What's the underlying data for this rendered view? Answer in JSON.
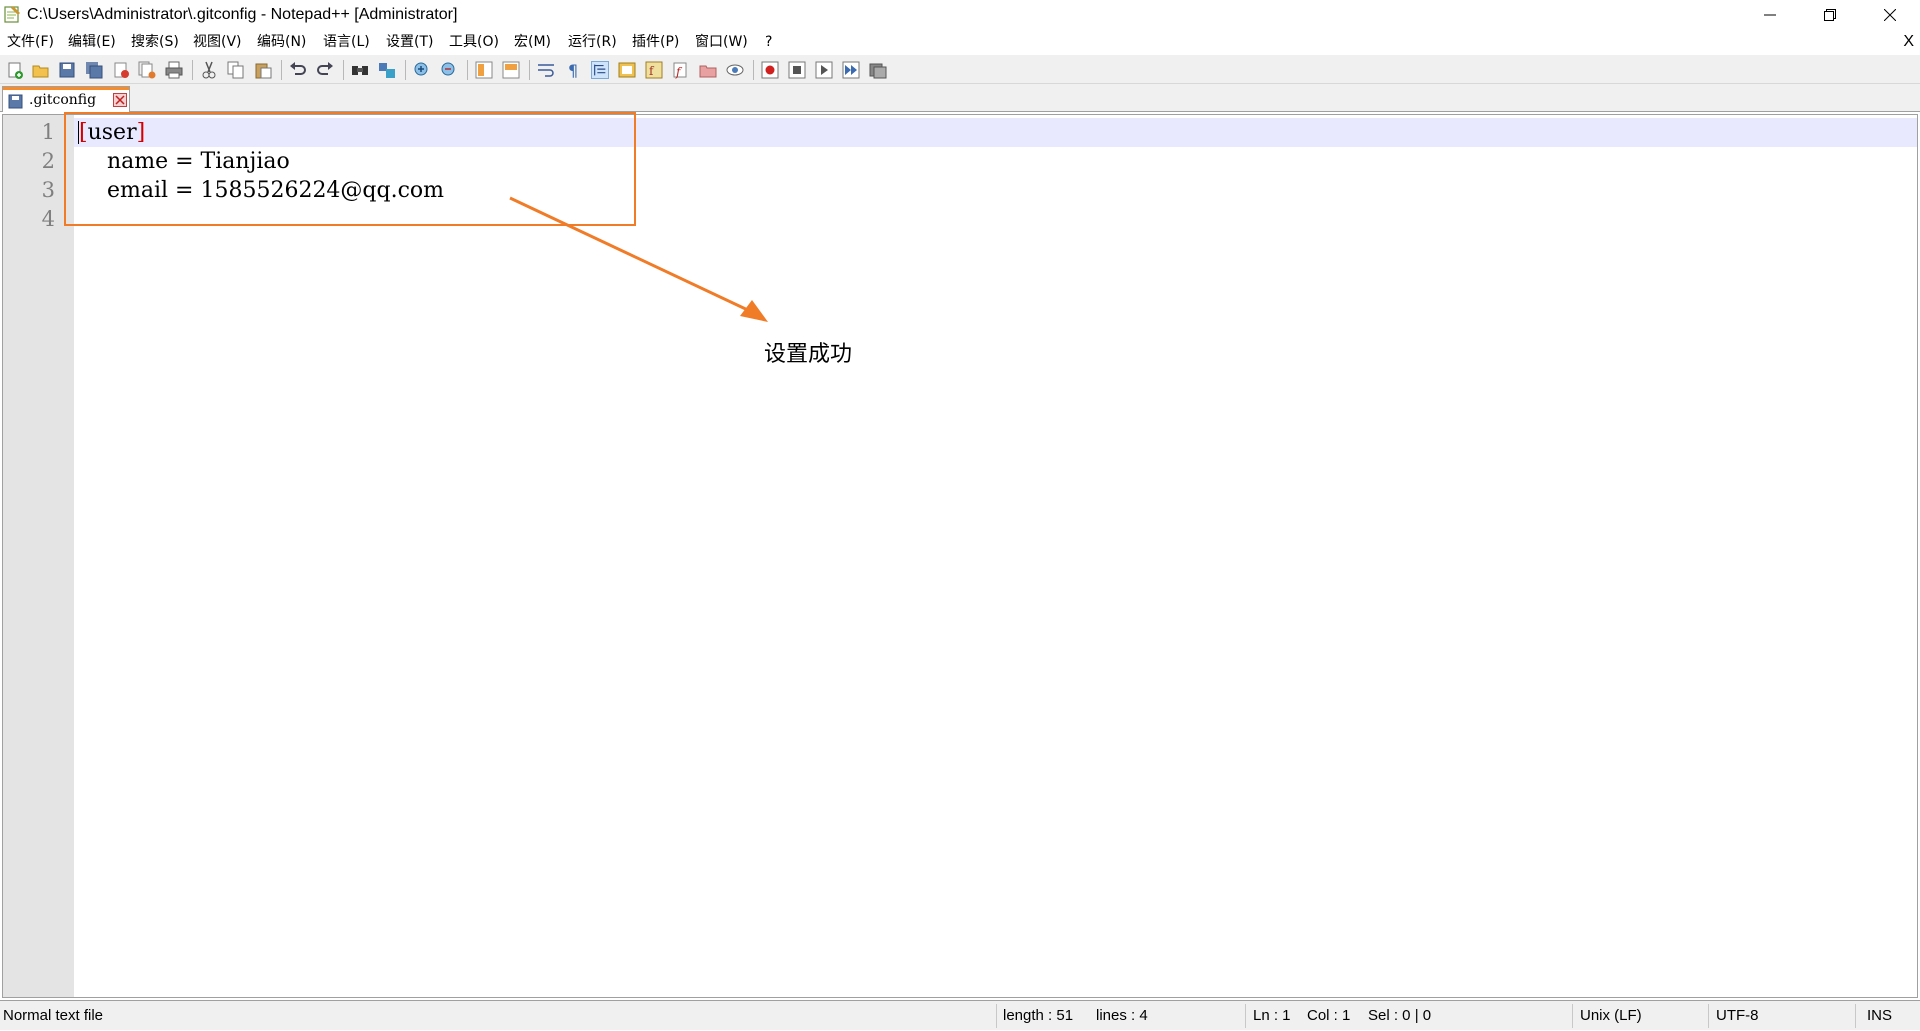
{
  "window": {
    "title": "C:\\Users\\Administrator\\.gitconfig - Notepad++ [Administrator]",
    "controls": {
      "minimize": "minimize-icon",
      "restore": "restore-icon",
      "close": "close-icon"
    }
  },
  "menu": {
    "items": [
      "文件(F)",
      "编辑(E)",
      "搜索(S)",
      "视图(V)",
      "编码(N)",
      "语言(L)",
      "设置(T)",
      "工具(O)",
      "宏(M)",
      "运行(R)",
      "插件(P)",
      "窗口(W)",
      "?"
    ],
    "close_doc": "X"
  },
  "toolbar": {
    "icons": [
      "new-file-icon",
      "open-file-icon",
      "save-icon",
      "save-all-icon",
      "close-icon",
      "close-all-icon",
      "print-icon",
      "cut-icon",
      "copy-icon",
      "paste-icon",
      "undo-icon",
      "redo-icon",
      "find-icon",
      "replace-icon",
      "zoom-in-icon",
      "zoom-out-icon",
      "sync-vertical-icon",
      "sync-horizontal-icon",
      "word-wrap-icon",
      "show-all-chars-icon",
      "indent-guide-icon",
      "doc-map-icon",
      "function-list-icon",
      "folder-workspace-icon",
      "monitoring-icon",
      "record-macro-icon",
      "stop-macro-icon",
      "play-macro-icon",
      "run-macro-multiple-icon",
      "save-macro-icon"
    ]
  },
  "tab": {
    "label": ".gitconfig"
  },
  "editor": {
    "line_numbers": [
      "1",
      "2",
      "3",
      "4"
    ],
    "lines": [
      {
        "bracket_open": "[",
        "section": "user",
        "bracket_close": "]"
      },
      {
        "text": "    name = Tianjiao"
      },
      {
        "text": "    email = 1585526224@qq.com"
      },
      {
        "text": ""
      }
    ]
  },
  "annotation": {
    "callout": "设置成功",
    "color": "#f07c28"
  },
  "status": {
    "file_type": "Normal text file",
    "length": "length : 51",
    "lines": "lines : 4",
    "ln": "Ln : 1",
    "col": "Col : 1",
    "sel": "Sel : 0 | 0",
    "eol": "Unix (LF)",
    "encoding": "UTF-8",
    "mode": "INS"
  }
}
